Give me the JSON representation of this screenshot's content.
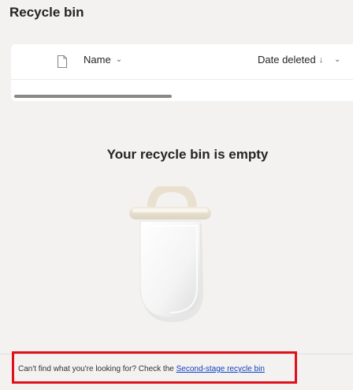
{
  "page": {
    "title": "Recycle bin"
  },
  "list": {
    "columns": {
      "name": "Name",
      "date_deleted": "Date deleted"
    },
    "icons": {
      "file_type": "file-icon",
      "name_sort": "chevron-down-icon",
      "date_sort": "arrow-down-icon",
      "date_menu": "chevron-down-icon"
    },
    "scroll_position": 0
  },
  "empty_state": {
    "message": "Your recycle bin is empty",
    "illustration": "trash-bin-illustration"
  },
  "footer": {
    "prompt": "Can't find what you're looking for? Check the ",
    "link_label": "Second-stage recycle bin"
  },
  "colors": {
    "highlight": "#e0101b",
    "link": "#0f3fbf",
    "background": "#f3f2f1"
  }
}
